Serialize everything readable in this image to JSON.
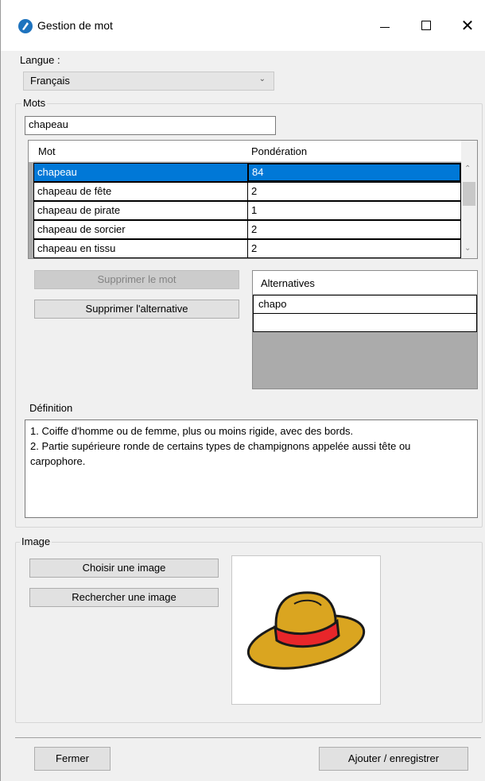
{
  "window": {
    "title": "Gestion de mot"
  },
  "language": {
    "label": "Langue :",
    "selected": "Français"
  },
  "words_group": {
    "title": "Mots",
    "search_value": "chapeau",
    "columns": [
      "Mot",
      "Pondération"
    ],
    "rows": [
      {
        "mot": "chapeau",
        "ponderation": "84"
      },
      {
        "mot": "chapeau de fête",
        "ponderation": "2"
      },
      {
        "mot": "chapeau de pirate",
        "ponderation": "1"
      },
      {
        "mot": "chapeau de sorcier",
        "ponderation": "2"
      },
      {
        "mot": "chapeau en tissu",
        "ponderation": "2"
      }
    ],
    "delete_word_label": "Supprimer le mot",
    "delete_alternative_label": "Supprimer l'alternative",
    "alternatives_header": "Alternatives",
    "alternatives": [
      "chapo",
      ""
    ],
    "definition_label": "Définition",
    "definition_lines": [
      "1. Coiffe d'homme ou de femme, plus ou moins rigide, avec des bords.",
      "2. Partie supérieure ronde de certains types de champignons appelée aussi tête ou",
      "carpophore."
    ]
  },
  "image_group": {
    "title": "Image",
    "choose_label": "Choisir une image",
    "search_label": "Rechercher une image",
    "colors": {
      "hat": "#daa520",
      "band": "#e8262a",
      "outline": "#1a1a1a"
    }
  },
  "footer": {
    "close_label": "Fermer",
    "save_label": "Ajouter / enregistrer"
  }
}
